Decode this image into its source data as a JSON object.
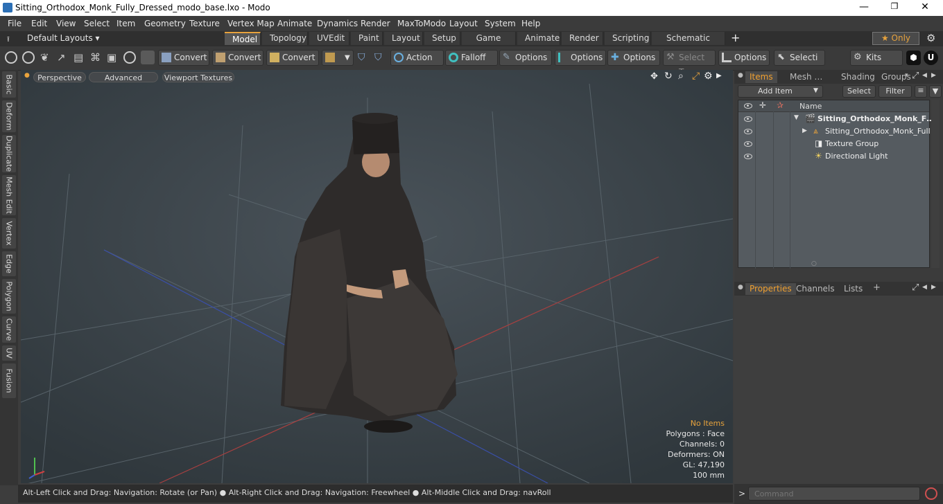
{
  "window": {
    "title": "Sitting_Orthodox_Monk_Fully_Dressed_modo_base.lxo - Modo",
    "minimize": "—",
    "maximize": "❐",
    "close": "✕"
  },
  "menu": [
    "File",
    "Edit",
    "View",
    "Select",
    "Item",
    "Geometry",
    "Texture",
    "Vertex Map",
    "Animate",
    "Dynamics",
    "Render",
    "MaxToModo",
    "Layout",
    "System",
    "Help"
  ],
  "layouts": {
    "preset": "Default Layouts ▾",
    "tabs": [
      "Model",
      "Topology",
      "UVEdit",
      "Paint",
      "Layout",
      "Setup",
      "Game Tools",
      "Animate",
      "Render",
      "Scripting",
      "Schematic Fusion"
    ],
    "active": "Model",
    "add": "+",
    "only": "★  Only"
  },
  "toolbar": {
    "convert1": "Convert",
    "convert2": "Convert",
    "convert3": "Convert",
    "action": "Action  …",
    "falloff": "Falloff",
    "options1": "Options",
    "options2": "Options",
    "options3": "Options",
    "select_t": "Select T…",
    "options4": "Options",
    "selecti": "Selecti …",
    "kits": "Kits"
  },
  "left_tabs": [
    "Basic",
    "Deform",
    "Duplicate",
    "Mesh Edit",
    "Vertex",
    "Edge",
    "Polygon",
    "Curve",
    "UV",
    "Fusion"
  ],
  "viewport": {
    "perspective": "Perspective",
    "advanced": "Advanced",
    "textures": "Viewport Textures",
    "hud": {
      "items": "No Items",
      "polygons": "Polygons : Face",
      "channels": "Channels: 0",
      "deformers": "Deformers: ON",
      "gl": "GL: 47,190",
      "scale": "100 mm"
    }
  },
  "status": {
    "text": "Alt-Left Click and Drag: Navigation: Rotate (or Pan) ●  Alt-Right Click and Drag: Navigation: Freewheel ●  Alt-Middle Click and Drag: navRoll"
  },
  "items_panel": {
    "tabs": [
      "Items",
      "Mesh …",
      "Shading",
      "Groups"
    ],
    "add_item": "Add Item",
    "select": "Select",
    "filter": "Filter",
    "name_header": "Name",
    "rows": [
      {
        "label": "Sitting_Orthodox_Monk_F…",
        "icon": "scene-icon"
      },
      {
        "label": "Sitting_Orthodox_Monk_Full …",
        "icon": "mesh-icon"
      },
      {
        "label": "Texture Group",
        "icon": "texture-group-icon"
      },
      {
        "label": "Directional Light",
        "icon": "light-icon"
      }
    ]
  },
  "props_panel": {
    "tabs": [
      "Properties",
      "Channels",
      "Lists"
    ],
    "add": "+"
  },
  "command": {
    "placeholder": "Command",
    "prompt": ">"
  },
  "colors": {
    "accent": "#e8a33d",
    "viewport_bg": "#3b444a"
  }
}
